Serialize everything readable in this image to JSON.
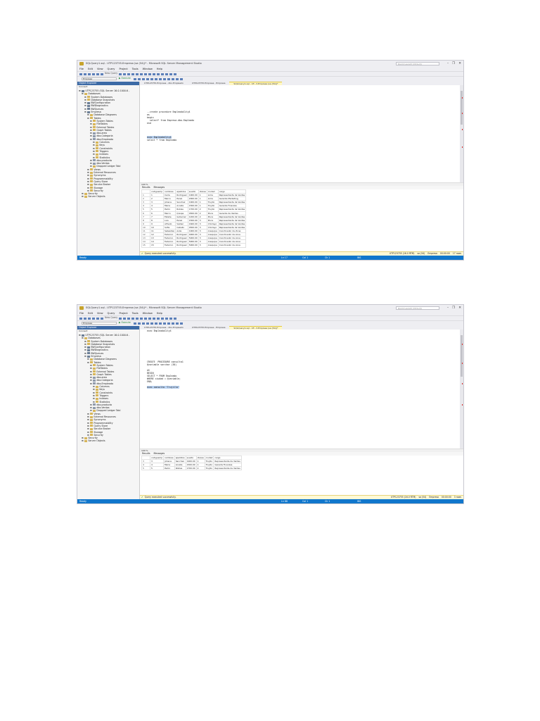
{
  "colors": {
    "accent": "#1177cc",
    "oe_header": "#3c6aa6",
    "active_tab": "#fff7c4",
    "keyword": "#1a3fd0",
    "selection": "#b9d2f2"
  },
  "shots": [
    {
      "title": "SQLQuery1.sql - UTP123755.Empresa (sa (54))* - Microsoft SQL Server Management Studio",
      "quick_launch": "Quick Launch (Ctrl+Q)",
      "menu": [
        "File",
        "Edit",
        "View",
        "Query",
        "Project",
        "Tools",
        "Window",
        "Help"
      ],
      "new_query": "New Query",
      "database": "Empresa",
      "execute": "Execute",
      "oe_title": "Object Explorer",
      "oe_connect": "Connect",
      "tree": [
        {
          "label": "UTP123755 (SQL Server 16.0.1000.6 -",
          "level": 0,
          "kind": "db"
        },
        {
          "label": "Databases",
          "level": 1,
          "kind": "folder"
        },
        {
          "label": "System Databases",
          "level": 2,
          "kind": "folder"
        },
        {
          "label": "Database Snapshots",
          "level": 2,
          "kind": "folder"
        },
        {
          "label": "BWConfiguration",
          "level": 2,
          "kind": "db"
        },
        {
          "label": "BWDiagnostics",
          "level": 2,
          "kind": "db"
        },
        {
          "label": "BWQueues",
          "level": 2,
          "kind": "db"
        },
        {
          "label": "Empresa",
          "level": 2,
          "kind": "db"
        },
        {
          "label": "Database Diagrams",
          "level": 3,
          "kind": "folder"
        },
        {
          "label": "Tables",
          "level": 3,
          "kind": "folder"
        },
        {
          "label": "System Tables",
          "level": 4,
          "kind": "folder"
        },
        {
          "label": "FileTables",
          "level": 4,
          "kind": "folder"
        },
        {
          "label": "External Tables",
          "level": 4,
          "kind": "folder"
        },
        {
          "label": "Graph Tables",
          "level": 4,
          "kind": "folder"
        },
        {
          "label": "dbo.area",
          "level": 4,
          "kind": "tbl"
        },
        {
          "label": "dbo.Categoria",
          "level": 4,
          "kind": "tbl"
        },
        {
          "label": "dbo.Empleado",
          "level": 4,
          "kind": "tbl"
        },
        {
          "label": "Columns",
          "level": 5,
          "kind": "folder"
        },
        {
          "label": "Keys",
          "level": 5,
          "kind": "folder"
        },
        {
          "label": "Constraints",
          "level": 5,
          "kind": "folder"
        },
        {
          "label": "Triggers",
          "level": 5,
          "kind": "folder"
        },
        {
          "label": "Indexes",
          "level": 5,
          "kind": "folder"
        },
        {
          "label": "Statistics",
          "level": 5,
          "kind": "folder"
        },
        {
          "label": "dbo.producto",
          "level": 4,
          "kind": "tbl"
        },
        {
          "label": "dbo.Ventas",
          "level": 4,
          "kind": "tbl"
        },
        {
          "label": "Dropped Ledger Tabl",
          "level": 4,
          "kind": "folder"
        },
        {
          "label": "Views",
          "level": 3,
          "kind": "folder"
        },
        {
          "label": "External Resources",
          "level": 3,
          "kind": "folder"
        },
        {
          "label": "Synonyms",
          "level": 3,
          "kind": "folder"
        },
        {
          "label": "Programmability",
          "level": 3,
          "kind": "folder"
        },
        {
          "label": "Query Store",
          "level": 3,
          "kind": "folder"
        },
        {
          "label": "Service Broker",
          "level": 3,
          "kind": "folder"
        },
        {
          "label": "Storage",
          "level": 3,
          "kind": "folder"
        },
        {
          "label": "Security",
          "level": 3,
          "kind": "folder"
        },
        {
          "label": "Security",
          "level": 1,
          "kind": "folder"
        },
        {
          "label": "Server Objects",
          "level": 1,
          "kind": "folder"
        }
      ],
      "tabs": [
        {
          "label": "UTP123755.Empresa - dbo.Empleado",
          "active": false
        },
        {
          "label": "UTP123755.Empresa - Empresa",
          "active": false
        },
        {
          "label": "SQLQuery1.sql - UT...3.Empresa (sa (54))*",
          "active": true
        }
      ],
      "code": [
        {
          "text": "",
          "sel": false
        },
        {
          "text": "",
          "sel": false
        },
        {
          "text": "",
          "sel": false
        },
        {
          "text": "",
          "sel": false
        },
        {
          "text": "",
          "sel": false
        },
        {
          "text": "",
          "sel": false
        },
        {
          "text": "",
          "sel": false
        },
        {
          "text": "",
          "sel": false
        },
        {
          "text": "",
          "sel": false
        },
        {
          "text": "--create procedure EmpleadoCity4",
          "sel": false
        },
        {
          "text": "as",
          "sel": false
        },
        {
          "text": "begin",
          "sel": false
        },
        {
          "text": "  select* from Empresa.dbo.Empleado",
          "sel": false
        },
        {
          "text": "end",
          "sel": false
        },
        {
          "text": "",
          "sel": false
        },
        {
          "text": "",
          "sel": false
        },
        {
          "text": "",
          "sel": false
        },
        {
          "text": "",
          "sel": false
        },
        {
          "text": "exec EmpleadoCity4",
          "sel": true
        },
        {
          "text": "select * from Empleado",
          "sel": false
        }
      ],
      "zoom": "100 %",
      "results_tab": "Results",
      "messages_tab": "Messages",
      "columns": [
        "codigoemp",
        "nombres",
        "apellidos",
        "sueldo",
        "idarea",
        "ciudad",
        "cargo"
      ],
      "rows": [
        [
          "1",
          "Carla",
          "Rodriguez",
          "1900.00",
          "1",
          "Lima",
          "Representante de Ventas"
        ],
        [
          "2",
          "Marco",
          "Perez",
          "2000.00",
          "1",
          "Lima",
          "Gerente Marketing"
        ],
        [
          "3",
          "Johana",
          "Sanchez",
          "1900.00",
          "1",
          "Trujillo",
          "Representante de Ventas"
        ],
        [
          "4",
          "Maria",
          "Acosta",
          "1500.00",
          "1",
          "Trujillo",
          "Gerente Finanzas"
        ],
        [
          "5",
          "Pedro",
          "Robles",
          "1700.00",
          "2",
          "Trujillo",
          "Representante de Ventas"
        ],
        [
          "6",
          "Marco",
          "Quispe",
          "4500.00",
          "2",
          "Piura",
          "Gerente de Ventas"
        ],
        [
          "7",
          "Estelle",
          "Gutierrez",
          "1200.00",
          "2",
          "Piura",
          "Representante de Ventas"
        ],
        [
          "8",
          "Luis",
          "Perez",
          "1500.00",
          "3",
          "Piura",
          "Representante de Ventas"
        ],
        [
          "9",
          "Alfredo",
          "Valdez",
          "1600.00",
          "3",
          "Chiclayo",
          "Representante de Ventas"
        ],
        [
          "10",
          "Sofia",
          "Caballo",
          "4500.00",
          "3",
          "Chiclayo",
          "Representante de Ventas"
        ],
        [
          "11",
          "Sebastian",
          "Avila",
          "1900.00",
          "3",
          "Arequipa",
          "Coordinador de Zona"
        ],
        [
          "12",
          "Federico",
          "Rodriguez",
          "4000.00",
          "3",
          "Arequipa",
          "Coordinador de zona"
        ],
        [
          "13",
          "Federico",
          "Rodriguez",
          "5000.00",
          "3",
          "Arequipa",
          "Coordinador de zona"
        ],
        [
          "14",
          "Federico",
          "Rodriguez",
          "5000.00",
          "3",
          "Arequipa",
          "Coordinador de zona"
        ],
        [
          "15",
          "Federico",
          "Rodriguez",
          "5000.00",
          "3",
          "Arequipa",
          "Coordinador de zona"
        ]
      ],
      "query_status": "Query executed successfully.",
      "server": "UTP123755 (16.0 RTM)",
      "user": "sa (54)",
      "db": "Empresa",
      "elapsed": "00:00:00",
      "row_count": "17 rows",
      "status_ready": "Ready",
      "status_ln": "Ln 17",
      "status_col": "Col 1",
      "status_ch": "Ch 1",
      "status_ins": "INS"
    },
    {
      "title": "SQLQuery1.sql - UTP123755.Empresa (sa (54))* - Microsoft SQL Server Management Studio",
      "quick_launch": "Quick Launch (Ctrl+Q)",
      "menu": [
        "File",
        "Edit",
        "View",
        "Query",
        "Project",
        "Tools",
        "Window",
        "Help"
      ],
      "new_query": "New Query",
      "database": "Empresa",
      "execute": "Execute",
      "oe_title": "Object Explorer",
      "oe_connect": "Connect",
      "tree": [
        {
          "label": "UTP123755 (SQL Server 16.0.1000.6 -",
          "level": 0,
          "kind": "db"
        },
        {
          "label": "Databases",
          "level": 1,
          "kind": "folder"
        },
        {
          "label": "System Databases",
          "level": 2,
          "kind": "folder"
        },
        {
          "label": "Database Snapshots",
          "level": 2,
          "kind": "folder"
        },
        {
          "label": "BWConfiguration",
          "level": 2,
          "kind": "db"
        },
        {
          "label": "BWDiagnostics",
          "level": 2,
          "kind": "db"
        },
        {
          "label": "BWQueues",
          "level": 2,
          "kind": "db"
        },
        {
          "label": "Empresa",
          "level": 2,
          "kind": "db"
        },
        {
          "label": "Database Diagrams",
          "level": 3,
          "kind": "folder"
        },
        {
          "label": "Tables",
          "level": 3,
          "kind": "folder"
        },
        {
          "label": "System Tables",
          "level": 4,
          "kind": "folder"
        },
        {
          "label": "FileTables",
          "level": 4,
          "kind": "folder"
        },
        {
          "label": "External Tables",
          "level": 4,
          "kind": "folder"
        },
        {
          "label": "Graph Tables",
          "level": 4,
          "kind": "folder"
        },
        {
          "label": "dbo.area",
          "level": 4,
          "kind": "tbl"
        },
        {
          "label": "dbo.Categoria",
          "level": 4,
          "kind": "tbl"
        },
        {
          "label": "dbo.Empleado",
          "level": 4,
          "kind": "tbl"
        },
        {
          "label": "Columns",
          "level": 5,
          "kind": "folder"
        },
        {
          "label": "Keys",
          "level": 5,
          "kind": "folder"
        },
        {
          "label": "Constraints",
          "level": 5,
          "kind": "folder"
        },
        {
          "label": "Triggers",
          "level": 5,
          "kind": "folder"
        },
        {
          "label": "Indexes",
          "level": 5,
          "kind": "folder"
        },
        {
          "label": "Statistics",
          "level": 5,
          "kind": "folder"
        },
        {
          "label": "dbo.producto",
          "level": 4,
          "kind": "tbl"
        },
        {
          "label": "dbo.Ventas",
          "level": 4,
          "kind": "tbl"
        },
        {
          "label": "Dropped Ledger Tabl",
          "level": 4,
          "kind": "folder"
        },
        {
          "label": "Views",
          "level": 3,
          "kind": "folder"
        },
        {
          "label": "External Resources",
          "level": 3,
          "kind": "folder"
        },
        {
          "label": "Synonyms",
          "level": 3,
          "kind": "folder"
        },
        {
          "label": "Programmability",
          "level": 3,
          "kind": "folder"
        },
        {
          "label": "Query Store",
          "level": 3,
          "kind": "folder"
        },
        {
          "label": "Service Broker",
          "level": 3,
          "kind": "folder"
        },
        {
          "label": "Storage",
          "level": 3,
          "kind": "folder"
        },
        {
          "label": "Security",
          "level": 3,
          "kind": "folder"
        },
        {
          "label": "Security",
          "level": 1,
          "kind": "folder"
        },
        {
          "label": "Server Objects",
          "level": 1,
          "kind": "folder"
        }
      ],
      "tabs": [
        {
          "label": "UTP123755.Empresa - dbo.Empleado",
          "active": false
        },
        {
          "label": "UTP123755.Empresa - Empresa",
          "active": false
        },
        {
          "label": "SQLQuery1.sql - UT...3.Empresa (sa (54))*",
          "active": true
        }
      ],
      "code": [
        {
          "text": "exec EmpleadoCity4",
          "sel": false
        },
        {
          "text": "",
          "sel": false
        },
        {
          "text": "",
          "sel": false
        },
        {
          "text": "",
          "sel": false
        },
        {
          "text": "",
          "sel": false
        },
        {
          "text": "",
          "sel": false
        },
        {
          "text": "",
          "sel": false
        },
        {
          "text": "",
          "sel": false
        },
        {
          "text": "",
          "sel": false
        },
        {
          "text": "",
          "sel": false
        },
        {
          "text": "",
          "sel": false
        },
        {
          "text": "CREATE  PROCEDURE consulta1",
          "sel": false
        },
        {
          "text": "@variable varchar (30)",
          "sel": false
        },
        {
          "text": "",
          "sel": false
        },
        {
          "text": "AS",
          "sel": false
        },
        {
          "text": "BEGIN",
          "sel": false
        },
        {
          "text": "SELECT * FROM Empleado",
          "sel": false
        },
        {
          "text": "WHERE ciudad = @variable;",
          "sel": false
        },
        {
          "text": "END;",
          "sel": false
        },
        {
          "text": "",
          "sel": false
        },
        {
          "text": "exec consulta 'Trujillo'",
          "sel": true
        }
      ],
      "zoom": "100 %",
      "results_tab": "Results",
      "messages_tab": "Messages",
      "columns": [
        "codigoemp",
        "nombres",
        "apellidos",
        "sueldo",
        "idarea",
        "ciudad",
        "cargo"
      ],
      "rows": [
        [
          "3",
          "Johana",
          "Sanchez",
          "1900.00",
          "1",
          "Trujillo",
          "Representante de Ventas"
        ],
        [
          "4",
          "Maria",
          "Acosta",
          "1500.00",
          "1",
          "Trujillo",
          "Gerente Finanzas"
        ],
        [
          "5",
          "Pedro",
          "Robles",
          "1700.00",
          "2",
          "Trujillo",
          "Representante de Ventas"
        ]
      ],
      "query_status": "Query executed successfully.",
      "server": "UTP123755 (16.0 RTM)",
      "user": "sa (54)",
      "db": "Empresa",
      "elapsed": "00:00:00",
      "row_count": "3 rows",
      "status_ready": "Ready",
      "status_ln": "Ln 88",
      "status_col": "Col 1",
      "status_ch": "Ch 1",
      "status_ins": "INS"
    }
  ]
}
